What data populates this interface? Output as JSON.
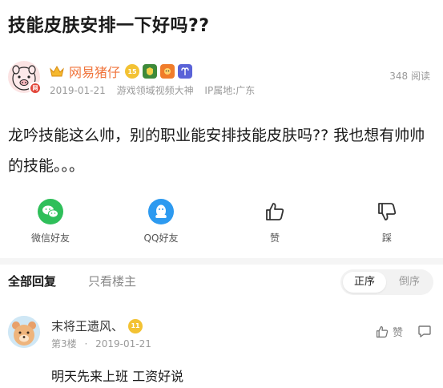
{
  "post": {
    "title": "技能皮肤安排一下好吗??",
    "author": {
      "name": "网易猪仔",
      "level_badge": "15",
      "date": "2019-01-21",
      "tag": "游戏领域视频大神",
      "ip": "IP属地:广东",
      "avatar_badge": "网"
    },
    "views": "348 阅读",
    "content": "龙吟技能这么帅，别的职业能安排技能皮肤吗?? 我也想有帅帅的技能。。。"
  },
  "actions": {
    "wechat": "微信好友",
    "qq": "QQ好友",
    "like": "赞",
    "dislike": "踩"
  },
  "replies_header": {
    "all": "全部回复",
    "owner_only": "只看楼主",
    "sort_asc": "正序",
    "sort_desc": "倒序"
  },
  "reply": {
    "name": "末将王遗风、",
    "level_badge": "11",
    "floor": "第3楼",
    "separator": "·",
    "date": "2019-01-21",
    "like_label": "赞",
    "text": "明天先来上班 工资好说"
  },
  "colors": {
    "author_name": "#f0733a",
    "wechat": "#2fbf5a",
    "qq": "#2d9af0",
    "level_badge": "#f3c233"
  }
}
